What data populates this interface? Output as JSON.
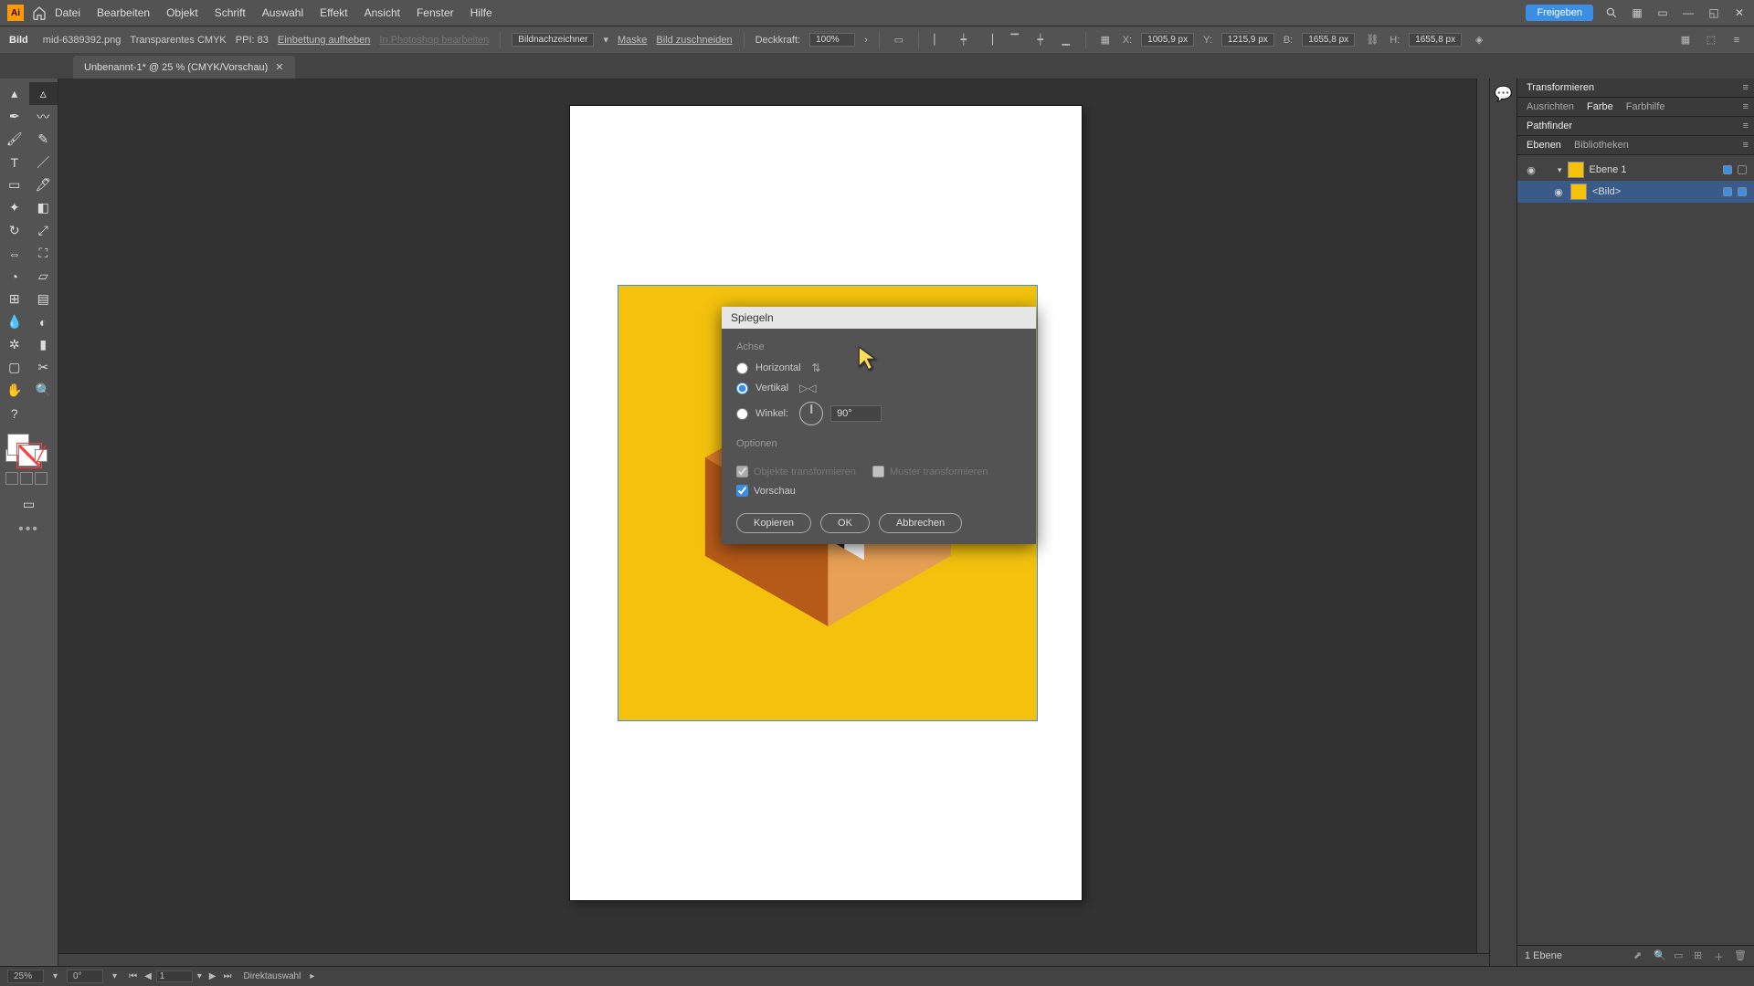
{
  "menubar": {
    "items": [
      "Datei",
      "Bearbeiten",
      "Objekt",
      "Schrift",
      "Auswahl",
      "Effekt",
      "Ansicht",
      "Fenster",
      "Hilfe"
    ],
    "share": "Freigeben"
  },
  "controlbar": {
    "object_type": "Bild",
    "filename": "mid-6389392.png",
    "colormode": "Transparentes CMYK",
    "ppi_label": "PPI:",
    "ppi_value": "83",
    "unembed": "Einbettung aufheben",
    "edit_ps": "In Photoshop bearbeiten",
    "tracer": "Bildnachzeichner",
    "mask": "Maske",
    "crop": "Bild zuschneiden",
    "opacity_lbl": "Deckkraft:",
    "opacity_val": "100%",
    "x_lbl": "X:",
    "x_val": "1005,9 px",
    "y_lbl": "Y:",
    "y_val": "1215,9 px",
    "w_lbl": "B:",
    "w_val": "1655,8 px",
    "h_lbl": "H:",
    "h_val": "1655,8 px"
  },
  "tab": {
    "title": "Unbenannt-1* @ 25 % (CMYK/Vorschau)"
  },
  "dialog": {
    "title": "Spiegeln",
    "axis_lbl": "Achse",
    "horizontal": "Horizontal",
    "vertical": "Vertikal",
    "angle_lbl": "Winkel:",
    "angle_val": "90°",
    "options_lbl": "Optionen",
    "transform_obj": "Objekte transformieren",
    "transform_pat": "Muster transformieren",
    "preview": "Vorschau",
    "copy": "Kopieren",
    "ok": "OK",
    "cancel": "Abbrechen"
  },
  "right": {
    "transform": "Transformieren",
    "align": "Ausrichten",
    "color": "Farbe",
    "colorguide": "Farbhilfe",
    "pathfinder": "Pathfinder",
    "layers": "Ebenen",
    "libraries": "Bibliotheken",
    "layer1": "Ebene 1",
    "image_item": "<Bild>",
    "footer_count": "1 Ebene"
  },
  "status": {
    "zoom": "25%",
    "rotate": "0°",
    "page": "1",
    "tool": "Direktauswahl"
  }
}
